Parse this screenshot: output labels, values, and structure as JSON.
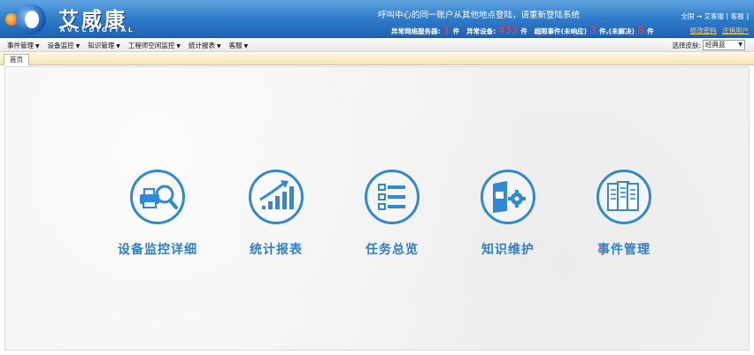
{
  "header": {
    "logo_cn": "艾威康",
    "logo_en": "AVCCDIGITAL",
    "notice": "呼叫中心的同一账户从其他地点登陆，请重新登陆系统",
    "stats": {
      "server_label": "异常网络服务器:",
      "server_count": "1",
      "server_unit": "件",
      "device_label": "异常设备:",
      "device_count": "433",
      "device_unit": "件",
      "event_label": "超限事件(未响应)",
      "event_unresponded": "3",
      "event_mid": "件,(未解决)",
      "event_unresolved": "8",
      "event_unit": "件"
    },
    "user_line": "全国 → 艾客服 [ 客服 ]",
    "links": {
      "change_password": "修改密码",
      "logout": "注销用户"
    }
  },
  "menu": [
    {
      "label": "事件管理"
    },
    {
      "label": "设备监控"
    },
    {
      "label": "知识管理"
    },
    {
      "label": "工程师空闲监控"
    },
    {
      "label": "统计报表"
    },
    {
      "label": "客服"
    }
  ],
  "skin": {
    "label": "选择皮肤:",
    "value": "经典蓝"
  },
  "tabs": [
    {
      "label": "首页"
    }
  ],
  "tiles": [
    {
      "label": "设备监控详细",
      "icon": "printer-search-icon"
    },
    {
      "label": "统计报表",
      "icon": "bar-chart-trend-icon"
    },
    {
      "label": "任务总览",
      "icon": "task-list-icon"
    },
    {
      "label": "知识维护",
      "icon": "book-gear-icon"
    },
    {
      "label": "事件管理",
      "icon": "documents-icon"
    }
  ],
  "colors": {
    "header_blue": "#2f7cca",
    "accent_blue": "#2f8ad6",
    "tile_text": "#2f7fc8",
    "alert_red": "#ff3a3a",
    "link_yellow": "#ffd36b"
  }
}
